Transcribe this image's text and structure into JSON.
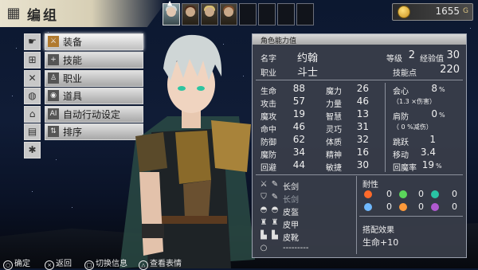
{
  "screen": {
    "title": "编组",
    "title_icon": "party-icon"
  },
  "party_slots": [
    {
      "state": "active",
      "has_arrow": true
    },
    {
      "state": "filled"
    },
    {
      "state": "filled"
    },
    {
      "state": "filled"
    },
    {
      "state": "empty"
    },
    {
      "state": "empty"
    },
    {
      "state": "empty"
    },
    {
      "state": "empty"
    }
  ],
  "gold": {
    "value": "1655",
    "unit": "G",
    "icon": "coin-icon"
  },
  "menu": [
    {
      "label": "装备",
      "icon": "hand-pointer-icon",
      "glyph": "sword-icon",
      "selected": true
    },
    {
      "label": "技能",
      "icon": "skill-tree-icon",
      "glyph": "plus-icon"
    },
    {
      "label": "职业",
      "icon": "cross-swords-icon",
      "glyph": "person-icon"
    },
    {
      "label": "道具",
      "icon": "bag-icon",
      "glyph": "pouch-icon"
    },
    {
      "label": "自动行动设定",
      "icon": "lock-icon",
      "glyph": "ai-icon"
    },
    {
      "label": "排序",
      "icon": "scroll-icon",
      "glyph": "sort-icon"
    },
    {
      "icon": "network-icon"
    }
  ],
  "stats_panel": {
    "title": "角色能力值",
    "name_label": "名字",
    "name": "约翰",
    "job_label": "职业",
    "job": "斗士",
    "level_label": "等级",
    "level": "2",
    "exp_label": "经验值",
    "exp": "30",
    "skill_points_label": "技能点",
    "skill_points": "220",
    "stats_col1": [
      {
        "label": "生命",
        "value": "88"
      },
      {
        "label": "攻击",
        "value": "57"
      },
      {
        "label": "魔攻",
        "value": "19"
      },
      {
        "label": "命中",
        "value": "46"
      },
      {
        "label": "防御",
        "value": "62"
      },
      {
        "label": "魔防",
        "value": "34"
      },
      {
        "label": "回避",
        "value": "44"
      }
    ],
    "stats_col2": [
      {
        "label": "魔力",
        "value": "26"
      },
      {
        "label": "力量",
        "value": "46"
      },
      {
        "label": "智慧",
        "value": "13"
      },
      {
        "label": "灵巧",
        "value": "31"
      },
      {
        "label": "体质",
        "value": "32"
      },
      {
        "label": "精神",
        "value": "16"
      },
      {
        "label": "敏捷",
        "value": "30"
      }
    ],
    "special": {
      "crit_label": "会心",
      "crit_value": "8",
      "crit_unit": "%",
      "crit_note": "（1.3 ×伤害）",
      "dodge_label": "肩防",
      "dodge_value": "0",
      "dodge_unit": "%",
      "dodge_note": "（ 0 %减伤）",
      "jump_label": "跳跃",
      "jump_value": "1",
      "move_label": "移动",
      "move_value": "3.4",
      "mp_regen_label": "回魔率",
      "mp_regen_value": "19",
      "mp_regen_unit": "%"
    },
    "equipment": [
      {
        "slot_icon": "sword-icon",
        "item_icon": "sword-icon",
        "name": "长剑",
        "dim": false
      },
      {
        "slot_icon": "shield-icon",
        "item_icon": "sword-icon",
        "name": "长剑",
        "dim": true
      },
      {
        "slot_icon": "helmet-icon",
        "item_icon": "helmet-icon",
        "name": "皮盔",
        "dim": false
      },
      {
        "slot_icon": "armor-icon",
        "item_icon": "armor-icon",
        "name": "皮甲",
        "dim": false
      },
      {
        "slot_icon": "boot-icon",
        "item_icon": "boot-icon",
        "name": "皮靴",
        "dim": false
      },
      {
        "slot_icon": "ring-icon",
        "item_icon": "",
        "name": "---------",
        "dim": false
      }
    ],
    "resist_label": "耐性",
    "resistances": [
      {
        "icon": "fire-icon",
        "color": "#ff6a2a",
        "value": "0"
      },
      {
        "icon": "wind-icon",
        "color": "#5bd65b",
        "value": "0"
      },
      {
        "icon": "earth-icon",
        "color": "#29c4a4",
        "value": "0"
      },
      {
        "icon": "ice-icon",
        "color": "#6fb8ff",
        "value": "0"
      },
      {
        "icon": "water-icon",
        "color": "#ff9a3a",
        "value": "0"
      },
      {
        "icon": "dark-icon",
        "color": "#b05ad0",
        "value": "0"
      }
    ],
    "bonus_label": "搭配效果",
    "bonus_value": "生命+10"
  },
  "hints": [
    {
      "key": "○",
      "label": "确定"
    },
    {
      "key": "×",
      "label": "返回"
    },
    {
      "key": "□",
      "label": "切换信息"
    },
    {
      "key": "△",
      "label": "查看表情"
    }
  ]
}
